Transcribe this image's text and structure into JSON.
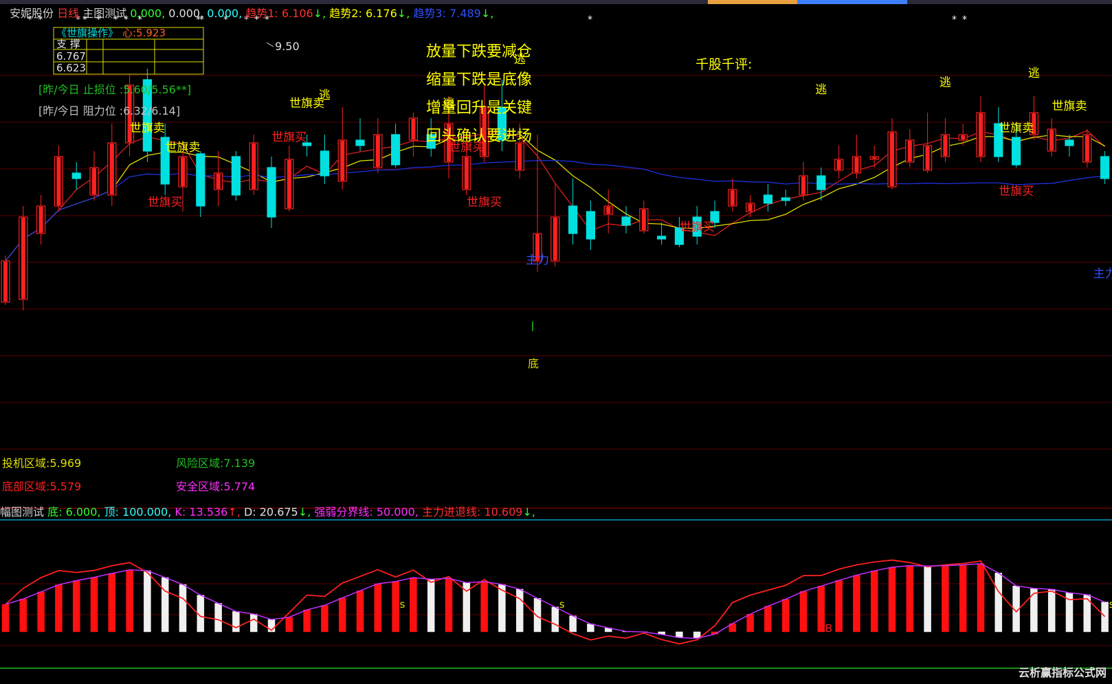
{
  "header": {
    "items": [
      {
        "text": "安妮股份",
        "color": "#d0d0d0"
      },
      {
        "text": " 日线",
        "color": "#ff3030"
      },
      {
        "text": " 主图测试 ",
        "color": "#d0d0d0"
      },
      {
        "text": "0.000,",
        "color": "#30ff30"
      },
      {
        "text": " 0.000,",
        "color": "#e0e0e0"
      },
      {
        "text": " 0.000,",
        "color": "#30ffff"
      },
      {
        "text": " 趋势1: 6.106",
        "color": "#ff3030"
      },
      {
        "text": "↓,",
        "color": "#30ff30"
      },
      {
        "text": " 趋势2: 6.176",
        "color": "#ffff00"
      },
      {
        "text": "↓,",
        "color": "#30ff30"
      },
      {
        "text": " 趋势3: 7.489",
        "color": "#3050ff"
      },
      {
        "text": "↓,",
        "color": "#30ff30"
      }
    ]
  },
  "table": {
    "title": "《世旗操作》",
    "heart": "心:5.923",
    "row1": "支 撑",
    "row2": "6.767",
    "row3": "6.623"
  },
  "info": {
    "stoploss": "[昨/今日 止损位 :5.60/5.56**]",
    "resist": "[昨/今日 阻力位 :6.32/6.14]"
  },
  "tips": [
    "放量下跌要减仓",
    "缩量下跌是底像",
    "增量回升是关键",
    "回头确认要进场"
  ],
  "comment": "千股千评:",
  "price_label": "9.50",
  "bottom_label": "底",
  "annotations": [
    {
      "text": "世旗卖",
      "color": "#ffff00",
      "i": 8,
      "p": 8.35
    },
    {
      "text": "世旗卖",
      "color": "#ffff00",
      "i": 10,
      "p": 8.0
    },
    {
      "text": "世旗买",
      "color": "#ff2020",
      "i": 9,
      "p": 7.0
    },
    {
      "text": "逃",
      "color": "#ffff00",
      "i": 18,
      "p": 8.95
    },
    {
      "text": "世旗卖",
      "color": "#ffff00",
      "i": 17,
      "p": 8.8
    },
    {
      "text": "世旗买",
      "color": "#ff2020",
      "i": 16,
      "p": 8.18
    },
    {
      "text": "逃",
      "color": "#ffff00",
      "i": 25,
      "p": 8.8
    },
    {
      "text": "世旗买",
      "color": "#ff2020",
      "i": 26,
      "p": 8.0
    },
    {
      "text": "世旗买",
      "color": "#ff2020",
      "i": 27,
      "p": 7.0
    },
    {
      "text": "逃",
      "color": "#ffff00",
      "i": 29,
      "p": 9.6
    },
    {
      "text": "主力",
      "color": "#3050ff",
      "i": 30,
      "p": 5.95
    },
    {
      "text": "世旗买",
      "color": "#ff2020",
      "i": 39,
      "p": 6.55
    },
    {
      "text": "逃",
      "color": "#ffff00",
      "i": 46,
      "p": 9.05
    },
    {
      "text": "逃",
      "color": "#ffff00",
      "i": 53,
      "p": 9.18
    },
    {
      "text": "世旗卖",
      "color": "#ffff00",
      "i": 57,
      "p": 8.35
    },
    {
      "text": "逃",
      "color": "#ffff00",
      "i": 58,
      "p": 9.35
    },
    {
      "text": "世旗卖",
      "color": "#ffff00",
      "i": 60,
      "p": 8.75
    },
    {
      "text": "世旗买",
      "color": "#ff2020",
      "i": 57,
      "p": 7.2
    },
    {
      "text": "主力",
      "color": "#3050ff",
      "i": 62,
      "p": 5.7
    }
  ],
  "zones": {
    "touji": "投机区域:5.969",
    "fengxian": "风险区域:7.139",
    "dibu": "底部区域:5.579",
    "anquan": "安全区域:5.774"
  },
  "sub_header": {
    "items": [
      {
        "text": "幅图测试",
        "color": "#d0d0d0"
      },
      {
        "text": " 底: 6.000,",
        "color": "#30ff30"
      },
      {
        "text": " 顶: 100.000,",
        "color": "#30ffff"
      },
      {
        "text": " K: 13.536",
        "color": "#ff30ff"
      },
      {
        "text": "↑,",
        "color": "#ff3030"
      },
      {
        "text": " D: 20.675",
        "color": "#e0e0e0"
      },
      {
        "text": "↓,",
        "color": "#30ff30"
      },
      {
        "text": " 强弱分界线: 50.000,",
        "color": "#ff30ff"
      },
      {
        "text": " 主力进退线: 10.609",
        "color": "#ff3030"
      },
      {
        "text": "↓,",
        "color": "#30ff30"
      }
    ]
  },
  "sub_markers": [
    {
      "text": "s",
      "i": 22
    },
    {
      "text": "s",
      "i": 31
    },
    {
      "text": "B",
      "i": 46
    },
    {
      "text": "s",
      "i": 62
    }
  ],
  "watermark": "云析赢指标公式网",
  "chart_data": [
    {
      "type": "candlestick",
      "ylim": [
        4.0,
        10.0
      ],
      "candles": [
        [
          5.25,
          6.0,
          5.2,
          6.1
        ],
        [
          5.3,
          6.8,
          5.1,
          7.0
        ],
        [
          6.5,
          7.0,
          6.3,
          7.2
        ],
        [
          7.0,
          7.9,
          6.9,
          8.1
        ],
        [
          7.6,
          7.5,
          7.3,
          7.8
        ],
        [
          7.2,
          7.7,
          7.1,
          8.0
        ],
        [
          7.2,
          8.15,
          7.0,
          8.5
        ],
        [
          8.15,
          9.2,
          7.9,
          9.4
        ],
        [
          9.3,
          8.0,
          7.8,
          9.5
        ],
        [
          8.25,
          7.4,
          7.2,
          8.5
        ],
        [
          7.35,
          7.9,
          6.9,
          8.0
        ],
        [
          7.95,
          7.0,
          6.8,
          8.0
        ],
        [
          7.3,
          7.6,
          7.0,
          8.0
        ],
        [
          7.9,
          7.2,
          7.1,
          8.0
        ],
        [
          7.3,
          8.15,
          7.2,
          8.3
        ],
        [
          7.7,
          6.8,
          6.6,
          7.9
        ],
        [
          6.95,
          7.85,
          6.9,
          8.1
        ],
        [
          8.15,
          8.1,
          7.9,
          8.3
        ],
        [
          8.0,
          7.55,
          7.4,
          8.3
        ],
        [
          7.45,
          8.2,
          7.3,
          8.8
        ],
        [
          8.2,
          8.1,
          8.0,
          8.6
        ],
        [
          7.7,
          8.3,
          7.6,
          8.6
        ],
        [
          8.3,
          7.75,
          7.7,
          8.5
        ],
        [
          8.2,
          8.6,
          7.9,
          8.7
        ],
        [
          8.3,
          8.05,
          7.9,
          8.6
        ],
        [
          7.8,
          8.5,
          7.5,
          9.0
        ],
        [
          7.3,
          7.9,
          7.2,
          8.4
        ],
        [
          7.9,
          8.8,
          7.8,
          9.2
        ],
        [
          8.8,
          8.2,
          8.0,
          9.3
        ],
        [
          7.65,
          8.15,
          7.5,
          8.5
        ],
        [
          6.0,
          6.5,
          5.8,
          8.3
        ],
        [
          6.0,
          6.8,
          5.9,
          7.4
        ],
        [
          7.0,
          6.5,
          6.3,
          7.5
        ],
        [
          6.9,
          6.4,
          6.2,
          7.1
        ],
        [
          6.85,
          7.0,
          6.5,
          7.3
        ],
        [
          6.8,
          6.65,
          6.5,
          7.0
        ],
        [
          6.55,
          6.95,
          6.5,
          7.1
        ],
        [
          6.45,
          6.4,
          6.3,
          6.7
        ],
        [
          6.6,
          6.3,
          6.25,
          6.8
        ],
        [
          6.8,
          6.45,
          6.3,
          7.0
        ],
        [
          6.9,
          6.7,
          6.6,
          7.1
        ],
        [
          7.0,
          7.3,
          6.9,
          7.5
        ],
        [
          6.9,
          7.05,
          6.8,
          7.2
        ],
        [
          7.2,
          7.05,
          6.9,
          7.4
        ],
        [
          7.15,
          7.1,
          7.0,
          7.3
        ],
        [
          7.2,
          7.55,
          7.1,
          7.8
        ],
        [
          7.55,
          7.3,
          7.1,
          7.7
        ],
        [
          7.65,
          7.85,
          7.5,
          8.1
        ],
        [
          7.6,
          7.9,
          7.5,
          8.3
        ],
        [
          7.85,
          7.9,
          7.7,
          8.1
        ],
        [
          7.35,
          8.35,
          7.3,
          8.6
        ],
        [
          7.8,
          8.2,
          7.7,
          8.4
        ],
        [
          7.65,
          8.1,
          7.6,
          8.7
        ],
        [
          7.9,
          8.3,
          7.8,
          8.6
        ],
        [
          8.2,
          8.3,
          8.1,
          8.5
        ],
        [
          7.9,
          8.7,
          7.8,
          9.0
        ],
        [
          8.5,
          7.9,
          7.8,
          8.8
        ],
        [
          8.25,
          7.75,
          7.7,
          8.5
        ],
        [
          8.3,
          8.7,
          8.2,
          9.0
        ],
        [
          8.0,
          8.4,
          7.9,
          8.6
        ],
        [
          8.2,
          8.1,
          7.9,
          8.3
        ],
        [
          7.8,
          8.3,
          7.7,
          8.4
        ],
        [
          7.9,
          7.5,
          7.4,
          8.0
        ]
      ]
    }
  ]
}
